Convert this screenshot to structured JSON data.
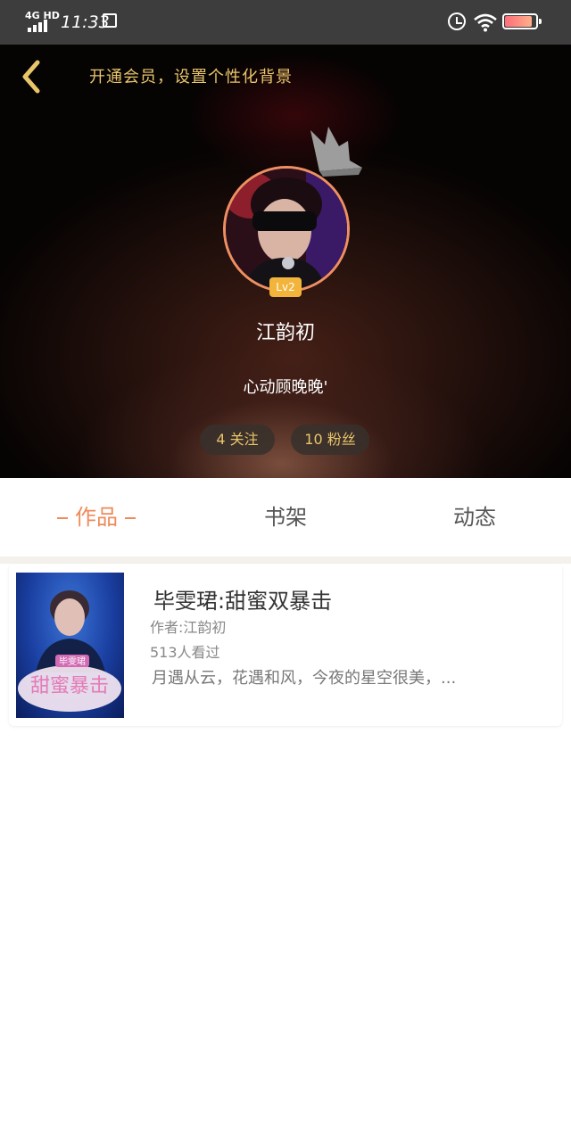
{
  "status_bar": {
    "network": "4G HD",
    "time": "11:33"
  },
  "header": {
    "vip_link": "开通会员，设置个性化背景",
    "level": "Lv2",
    "user_name": "江韵初",
    "signature": "心动顾晚晚'",
    "follow": "4 关注",
    "fans": "10 粉丝"
  },
  "tabs": [
    {
      "label": "作品",
      "active": true
    },
    {
      "label": "书架",
      "active": false
    },
    {
      "label": "动态",
      "active": false
    }
  ],
  "works": [
    {
      "title": "毕雯珺:甜蜜双暴击",
      "author": "作者:江韵初",
      "views": "513人看过",
      "description": "月遇从云，花遇和风，今夜的星空很美，...",
      "cover_tag": "毕雯珺",
      "cover_text": "甜蜜暴击"
    }
  ],
  "colors": {
    "accent": "#ef8a5a",
    "gold": "#e9c56a",
    "level_badge": "#f2b43a",
    "status_bar": "#3d3d3d"
  },
  "icons": {
    "back": "chevron-left-icon",
    "crown": "crown-icon",
    "alarm": "alarm-icon",
    "wifi": "wifi-icon",
    "battery": "battery-icon"
  }
}
